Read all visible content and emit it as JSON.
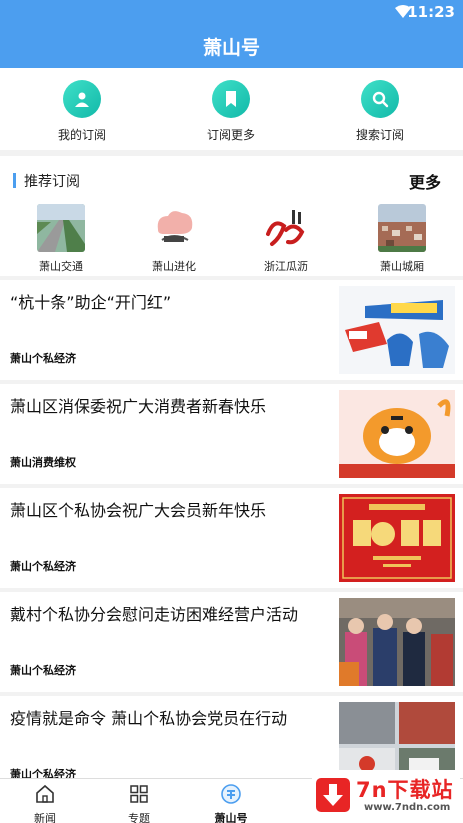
{
  "status": {
    "time": "11:23"
  },
  "appbar": {
    "title": "萧山号"
  },
  "quick_actions": [
    {
      "label": "我的订阅",
      "icon": "person-icon"
    },
    {
      "label": "订阅更多",
      "icon": "bookmark-icon"
    },
    {
      "label": "搜索订阅",
      "icon": "search-icon"
    }
  ],
  "recommend": {
    "heading": "推荐订阅",
    "more": "更多",
    "sources": [
      {
        "label": "萧山交通"
      },
      {
        "label": "萧山进化"
      },
      {
        "label": "浙江瓜沥"
      },
      {
        "label": "萧山城厢"
      }
    ]
  },
  "news": [
    {
      "headline": "“杭十条”助企“开门红”",
      "tag": "萧山个私经济"
    },
    {
      "headline": "萧山区消保委祝广大消费者新春快乐",
      "tag": "萧山消费维权"
    },
    {
      "headline": "萧山区个私协会祝广大会员新年快乐",
      "tag": "萧山个私经济"
    },
    {
      "headline": "戴村个私协分会慰问走访困难经营户活动",
      "tag": "萧山个私经济"
    },
    {
      "headline": "疫情就是命令 萧山个私协会党员在行动",
      "tag": "萧山个私经济"
    }
  ],
  "bottom_nav": [
    {
      "label": "新闻"
    },
    {
      "label": "专题"
    },
    {
      "label": "萧山号"
    }
  ],
  "watermark": {
    "brand": "7n下载站",
    "url": "www.7ndn.com"
  },
  "colors": {
    "primary": "#4c9eef",
    "accent": "#12b9a9",
    "watermark": "#e82525"
  }
}
